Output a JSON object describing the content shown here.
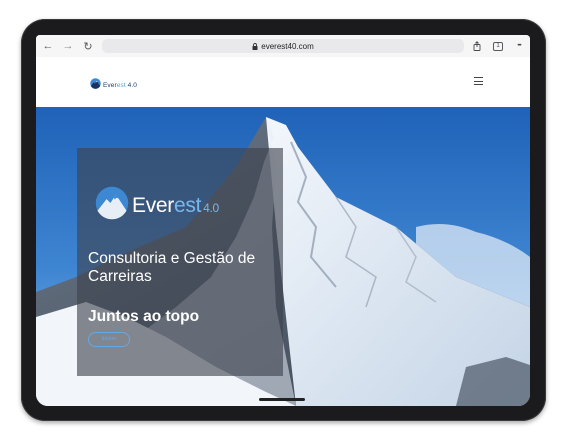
{
  "browser": {
    "url": "everest40.com",
    "tab_count": "1",
    "back_icon": "←",
    "forward_icon": "→",
    "reload_icon": "↻",
    "share_icon": "⇪",
    "more_icon": "•••"
  },
  "site": {
    "logo": {
      "prefix": "Ever",
      "accent": "est",
      "version": "4.0"
    },
    "menu_icon": "hamburger-menu-icon"
  },
  "hero": {
    "logo": {
      "prefix": "Ever",
      "accent": "est",
      "version": "4.0"
    },
    "title": "Consultoria e Gestão de Carreiras",
    "tagline": "Juntos ao topo",
    "button_label": "Iniciar"
  },
  "colors": {
    "brand_dark": "#1c3e6e",
    "brand_accent": "#5aa0de",
    "sky": "#2d74c8",
    "panel_overlay": "rgba(62,66,78,0.62)"
  }
}
